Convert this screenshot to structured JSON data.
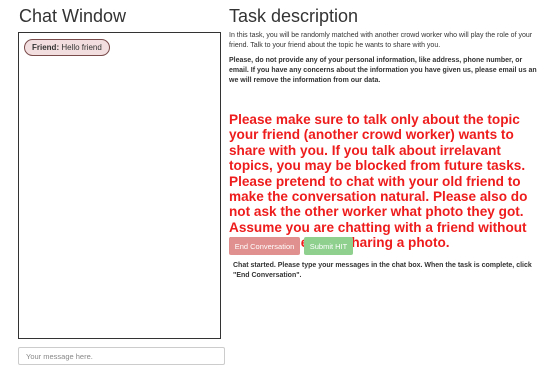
{
  "chat": {
    "title": "Chat Window",
    "messages": [
      {
        "sender": "Friend:",
        "text": "Hello friend"
      }
    ],
    "input_placeholder": "Your message here."
  },
  "task": {
    "title": "Task description",
    "intro": "In this task, you will be randomly matched with another crowd worker who will play the role of your friend. Talk to your friend about the topic he wants to share with you.",
    "privacy_notice": "Please, do not provide any of your personal information, like address, phone number, or email. If you have any concerns about the information you have given us, please email us and we will remove the information from our data.",
    "warning": "Please make sure to talk only about the topic your friend (another crowd worker) wants to share with you. If you talk about irrelavant topics, you may be blocked from future tasks. Please pretend to chat with your old friend to make the conversation natural. Please also do not ask the other worker what photo they got. Assume you are chatting with a friend without knowing they are sharing a photo.",
    "end_button": "End Conversation",
    "submit_button": "Submit HIT",
    "status": "Chat started. Please type your messages in the chat box. When the task is complete, click \"End Conversation\"."
  },
  "colors": {
    "warning_red": "#ee1c1c",
    "bubble_bg": "#f2dede",
    "end_button": "#e0908e",
    "submit_button": "#8fd08f"
  }
}
